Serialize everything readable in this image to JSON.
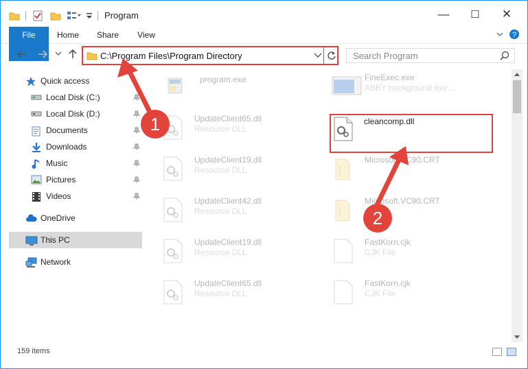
{
  "window": {
    "title": "Program",
    "controls": {
      "minimize": "—",
      "maximize": "☐",
      "close": "✕"
    }
  },
  "ribbon": {
    "tabs": [
      "File",
      "Home",
      "Share",
      "View"
    ]
  },
  "address": {
    "path": "C:\\Program Files\\Program Directory"
  },
  "search": {
    "placeholder": "Search Program"
  },
  "sidebar": {
    "quick_access": "Quick access",
    "items": [
      {
        "label": "Local Disk (C:)",
        "icon": "drive-icon",
        "pinned": true
      },
      {
        "label": "Local Disk (D:)",
        "icon": "drive-icon",
        "pinned": true
      },
      {
        "label": "Documents",
        "icon": "documents-icon",
        "pinned": true
      },
      {
        "label": "Downloads",
        "icon": "downloads-icon",
        "pinned": true
      },
      {
        "label": "Music",
        "icon": "music-icon",
        "pinned": true
      },
      {
        "label": "Pictures",
        "icon": "pictures-icon",
        "pinned": true
      },
      {
        "label": "Videos",
        "icon": "videos-icon",
        "pinned": true
      }
    ],
    "onedrive": "OneDrive",
    "thispc": "This PC",
    "network": "Network"
  },
  "files": {
    "left": [
      {
        "name": "program.exe",
        "desc": ""
      },
      {
        "name": "UpdateClient65.dll",
        "desc": "Resource DLL"
      },
      {
        "name": "UpdateClient19.dll",
        "desc": "Resource DLL"
      },
      {
        "name": "UpdateClient42.dll",
        "desc": "Resource DLL"
      },
      {
        "name": "UpdateClient19.dll",
        "desc": "Resource DLL"
      },
      {
        "name": "UpdateClient65.dll",
        "desc": "Resource DLL"
      }
    ],
    "right": [
      {
        "name": "FineExec.exe",
        "desc": "ABBY background exe..."
      },
      {
        "name": "cleancomp.dll",
        "desc": ""
      },
      {
        "name": "Microsoft.VC90.CRT",
        "desc": ""
      },
      {
        "name": "Microsoft.VC90.CRT",
        "desc": ""
      },
      {
        "name": "FastKorn.cjk",
        "desc": "CJK File"
      },
      {
        "name": "FastKorn.cjk",
        "desc": "CJK File"
      }
    ]
  },
  "status": {
    "items": "159 items"
  },
  "annotations": {
    "step1": "1",
    "step2": "2",
    "color": "#e2433b"
  }
}
